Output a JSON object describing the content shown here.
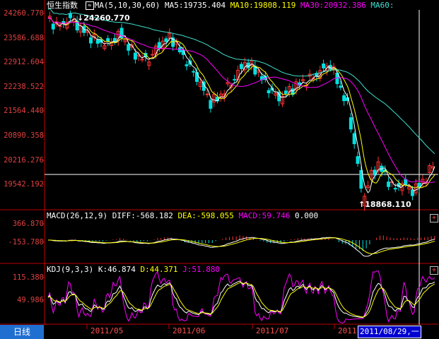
{
  "main_header": {
    "title": "恒生指数",
    "ma_label": "MA(5,10,30,60)",
    "ma5": "MA5:19735.404",
    "ma10": "MA10:19808.119",
    "ma30": "MA30:20932.386",
    "ma60": "MA60:"
  },
  "price_axis": [
    "24260.770",
    "23586.688",
    "22912.604",
    "22238.522",
    "21564.440",
    "20890.358",
    "20216.276",
    "19542.192"
  ],
  "annotations": {
    "high": "24260.770",
    "low": "18868.110"
  },
  "macd_header": {
    "label": "MACD(26,12,9)",
    "diff": "DIFF:-568.182",
    "dea": "DEA:-598.055",
    "macd": "MACD:59.746",
    "zero": "0.000"
  },
  "macd_axis": [
    "366.870",
    "-153.780"
  ],
  "kdj_header": {
    "label": "KDJ(9,3,3)",
    "k": "K:46.874",
    "d": "D:44.371",
    "j": "J:51.880"
  },
  "kdj_axis": [
    "115.380",
    "49.986"
  ],
  "bottom": {
    "period_tab": "日线",
    "months": [
      "2011/05",
      "2011/06",
      "2011/07",
      "2011"
    ],
    "cursor_date": "2011/08/29,一"
  },
  "colors": {
    "up": "#ff3232",
    "down": "#00e0e0",
    "ma5": "#ffffff",
    "ma10": "#ffff00",
    "ma30": "#ff00ff",
    "ma60": "#40e0d0",
    "axis": "#c00000",
    "grid": "#800000"
  },
  "icons": {
    "ma_toggle": "ma-toggle-icon",
    "expand": "plus-icon"
  }
}
